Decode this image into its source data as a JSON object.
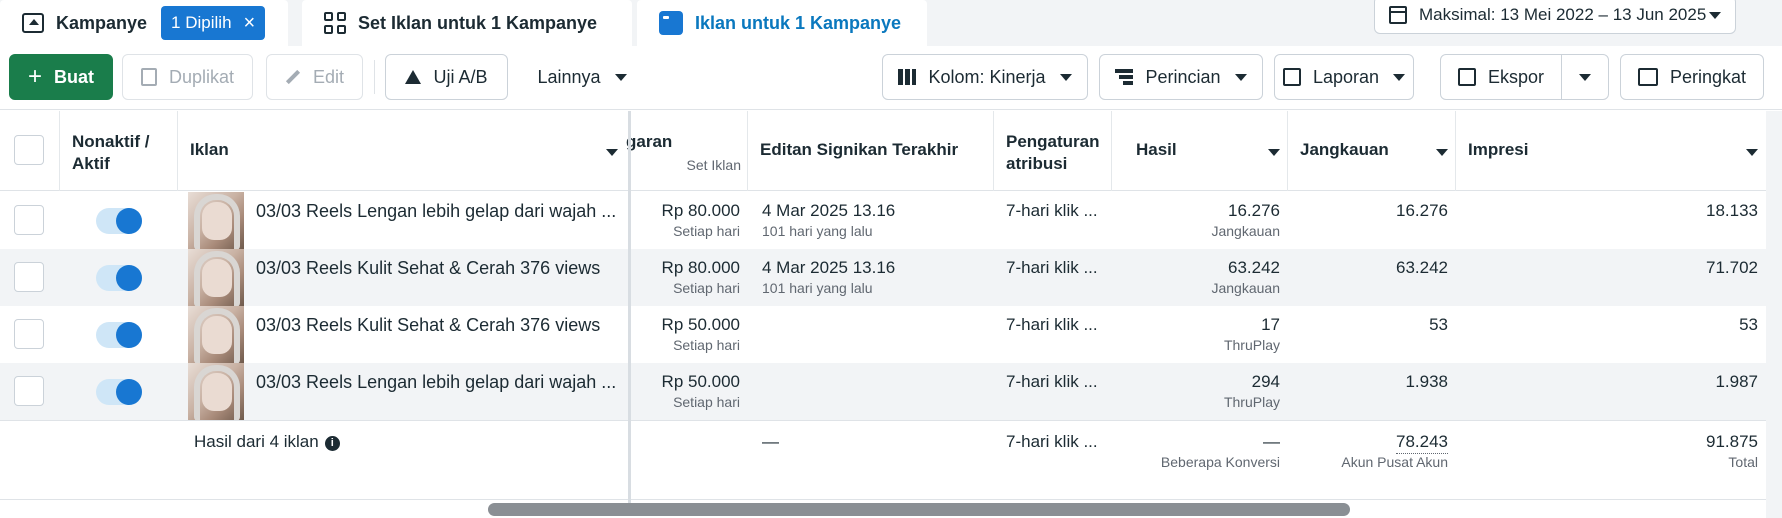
{
  "tabs": {
    "kampanye": {
      "label": "Kampanye",
      "chip": "1 Dipilih",
      "chip_close": "×"
    },
    "set_iklan": {
      "label": "Set Iklan untuk 1 Kampanye"
    },
    "iklan": {
      "label": "Iklan untuk 1 Kampanye"
    }
  },
  "date_range": "Maksimal: 13 Mei 2022 – 13 Jun 2025",
  "toolbar": {
    "buat": "Buat",
    "duplikat": "Duplikat",
    "edit": "Edit",
    "uji_ab": "Uji A/B",
    "lainnya": "Lainnya",
    "kolom": "Kolom: Kinerja",
    "perincian": "Perincian",
    "laporan": "Laporan",
    "ekspor": "Ekspor",
    "peringkat": "Peringkat"
  },
  "columns": {
    "toggle": "Nonaktif / Aktif",
    "iklan": "Iklan",
    "anggaran": "garan",
    "anggaran_sub": "Set Iklan",
    "editan": "Editan Signikan Terakhir",
    "atribusi": "Pengaturan atribusi",
    "hasil": "Hasil",
    "jangkauan": "Jangkauan",
    "impresi": "Impresi"
  },
  "rows": [
    {
      "name": "03/03 Reels Lengan lebih gelap dari wajah ...",
      "budget": "Rp 80.000",
      "budget_sub": "Setiap hari",
      "edit_date": "4 Mar 2025 13.16",
      "edit_ago": "101 hari yang lalu",
      "attribution": "7-hari klik ...",
      "result": "16.276",
      "result_sub": "Jangkauan",
      "reach": "16.276",
      "impressions": "18.133",
      "active": true
    },
    {
      "name": "03/03 Reels Kulit Sehat & Cerah 376 views",
      "budget": "Rp 80.000",
      "budget_sub": "Setiap hari",
      "edit_date": "4 Mar 2025 13.16",
      "edit_ago": "101 hari yang lalu",
      "attribution": "7-hari klik ...",
      "result": "63.242",
      "result_sub": "Jangkauan",
      "reach": "63.242",
      "impressions": "71.702",
      "active": true
    },
    {
      "name": "03/03 Reels Kulit Sehat & Cerah 376 views",
      "budget": "Rp 50.000",
      "budget_sub": "Setiap hari",
      "edit_date": "",
      "edit_ago": "",
      "attribution": "7-hari klik ...",
      "result": "17",
      "result_sub": "ThruPlay",
      "reach": "53",
      "impressions": "53",
      "active": true
    },
    {
      "name": "03/03 Reels Lengan lebih gelap dari wajah ...",
      "budget": "Rp 50.000",
      "budget_sub": "Setiap hari",
      "edit_date": "",
      "edit_ago": "",
      "attribution": "7-hari klik ...",
      "result": "294",
      "result_sub": "ThruPlay",
      "reach": "1.938",
      "impressions": "1.987",
      "active": true
    }
  ],
  "summary": {
    "label": "Hasil dari 4 iklan",
    "edit": "—",
    "attribution": "7-hari klik ...",
    "result": "—",
    "result_sub": "Beberapa Konversi",
    "reach": "78.243",
    "reach_sub": "Akun Pusat Akun",
    "impressions": "91.875",
    "impressions_sub": "Total"
  },
  "colors": {
    "accent": "#1877d2",
    "create_button": "#1a7d4b",
    "active_tab_text": "#0a78be"
  }
}
